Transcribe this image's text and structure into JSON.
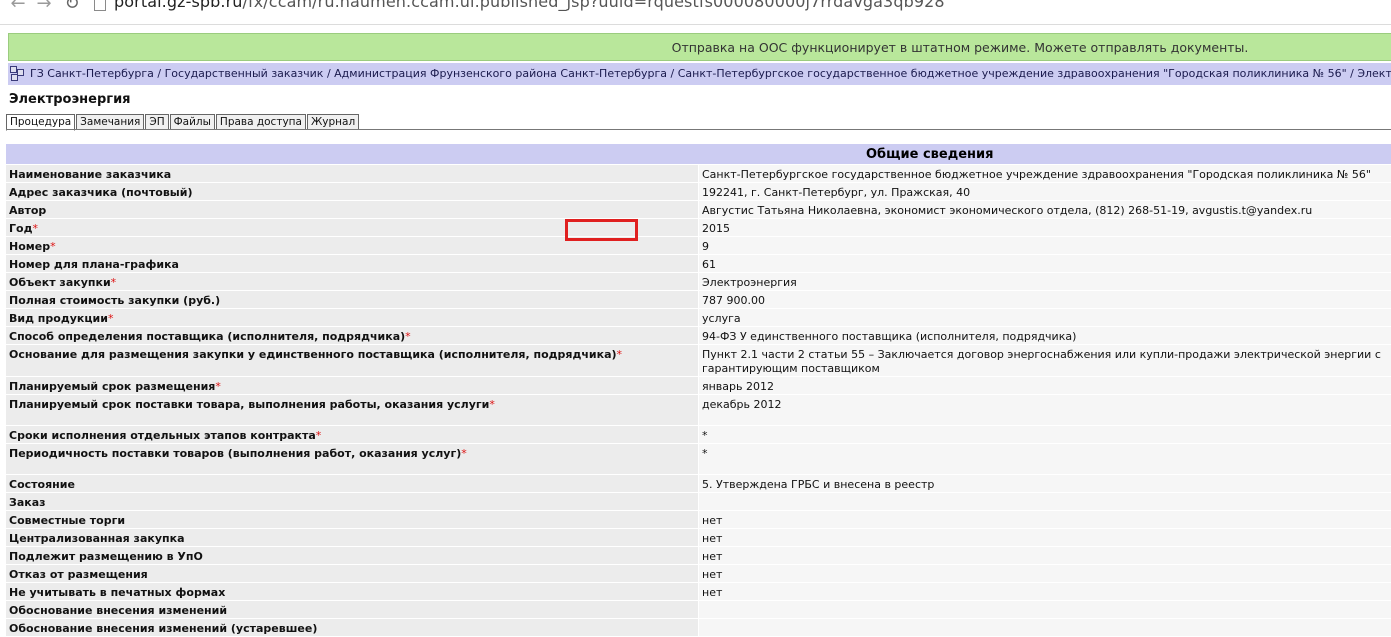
{
  "browser": {
    "url_host": "portal.gz-spb.ru",
    "url_path": "/fx/ccam/ru.naumen.ccam.ui.published_jsp?uuid=rquestfs000080000j7rrdavga3qb928"
  },
  "banner": {
    "text": "Отправка на ООС функционирует в штатном режиме. Можете отправлять документы."
  },
  "breadcrumb": {
    "text": "ГЗ Санкт-Петербурга / Государственный заказчик / Администрация Фрунзенского района Санкт-Петербурга / Санкт-Петербургское государственное бюджетное учреждение здравоохранения \"Городская поликлиника № 56\" / Электроэнергия [Г"
  },
  "page": {
    "title": "Электроэнергия"
  },
  "tabs": [
    {
      "label": "Процедура"
    },
    {
      "label": "Замечания"
    },
    {
      "label": "ЭП"
    },
    {
      "label": "Файлы"
    },
    {
      "label": "Права доступа"
    },
    {
      "label": "Журнал"
    }
  ],
  "section": {
    "title": "Общие сведения"
  },
  "rows": [
    {
      "label": "Наименование заказчика",
      "required": false,
      "value": "Санкт-Петербургское государственное бюджетное учреждение здравоохранения \"Городская поликлиника № 56\""
    },
    {
      "label": "Адрес заказчика (почтовый)",
      "required": false,
      "value": "192241, г. Санкт-Петербург, ул. Пражская, 40"
    },
    {
      "label": "Автор",
      "required": false,
      "value": "Августис Татьяна Николаевна, экономист экономического отдела, (812) 268-51-19, avgustis.t@yandex.ru"
    },
    {
      "label": "Год",
      "required": true,
      "value": "2015"
    },
    {
      "label": "Номер",
      "required": true,
      "value": "9"
    },
    {
      "label": "Номер для плана-графика",
      "required": false,
      "value": "61"
    },
    {
      "label": "Объект закупки",
      "required": true,
      "value": "Электроэнергия"
    },
    {
      "label": "Полная стоимость закупки (руб.)",
      "required": false,
      "value": "787 900.00"
    },
    {
      "label": "Вид продукции",
      "required": true,
      "value": "услуга"
    },
    {
      "label": "Способ определения поставщика (исполнителя, подрядчика)",
      "required": true,
      "value": "94-ФЗ У единственного поставщика (исполнителя, подрядчика)"
    },
    {
      "label": "Основание для размещения закупки у единственного поставщика (исполнителя, подрядчика)",
      "required": true,
      "value": "Пункт 2.1 части 2 статьи 55 – Заключается договор энергоснабжения или купли-продажи электрической энергии с гарантирующим поставщиком"
    },
    {
      "label": "Планируемый срок размещения",
      "required": true,
      "value": "январь 2012"
    },
    {
      "label": "Планируемый срок поставки товара, выполнения работы, оказания услуги",
      "required": true,
      "value": "декабрь 2012"
    },
    {
      "label": "Сроки исполнения отдельных этапов контракта",
      "required": true,
      "value": "*"
    },
    {
      "label": "Периодичность поставки товаров (выполнения работ, оказания услуг)",
      "required": true,
      "value": "*"
    },
    {
      "label": "Состояние",
      "required": false,
      "value": "5. Утверждена ГРБС и внесена в реестр"
    },
    {
      "label": "Заказ",
      "required": false,
      "value": ""
    },
    {
      "label": "Совместные торги",
      "required": false,
      "value": "нет"
    },
    {
      "label": "Централизованная закупка",
      "required": false,
      "value": "нет"
    },
    {
      "label": "Подлежит размещению в УпО",
      "required": false,
      "value": "нет"
    },
    {
      "label": "Отказ от размещения",
      "required": false,
      "value": "нет"
    },
    {
      "label": "Не учитывать в печатных формах",
      "required": false,
      "value": "нет"
    },
    {
      "label": "Обоснование внесения изменений",
      "required": false,
      "value": ""
    },
    {
      "label": "Обоснование внесения изменений (устаревшее)",
      "required": false,
      "value": ""
    }
  ],
  "colors": {
    "banner_bg": "#b9e79b",
    "header_bg": "#ccccf2",
    "label_bg": "#ececec",
    "highlight": "#e02020"
  }
}
